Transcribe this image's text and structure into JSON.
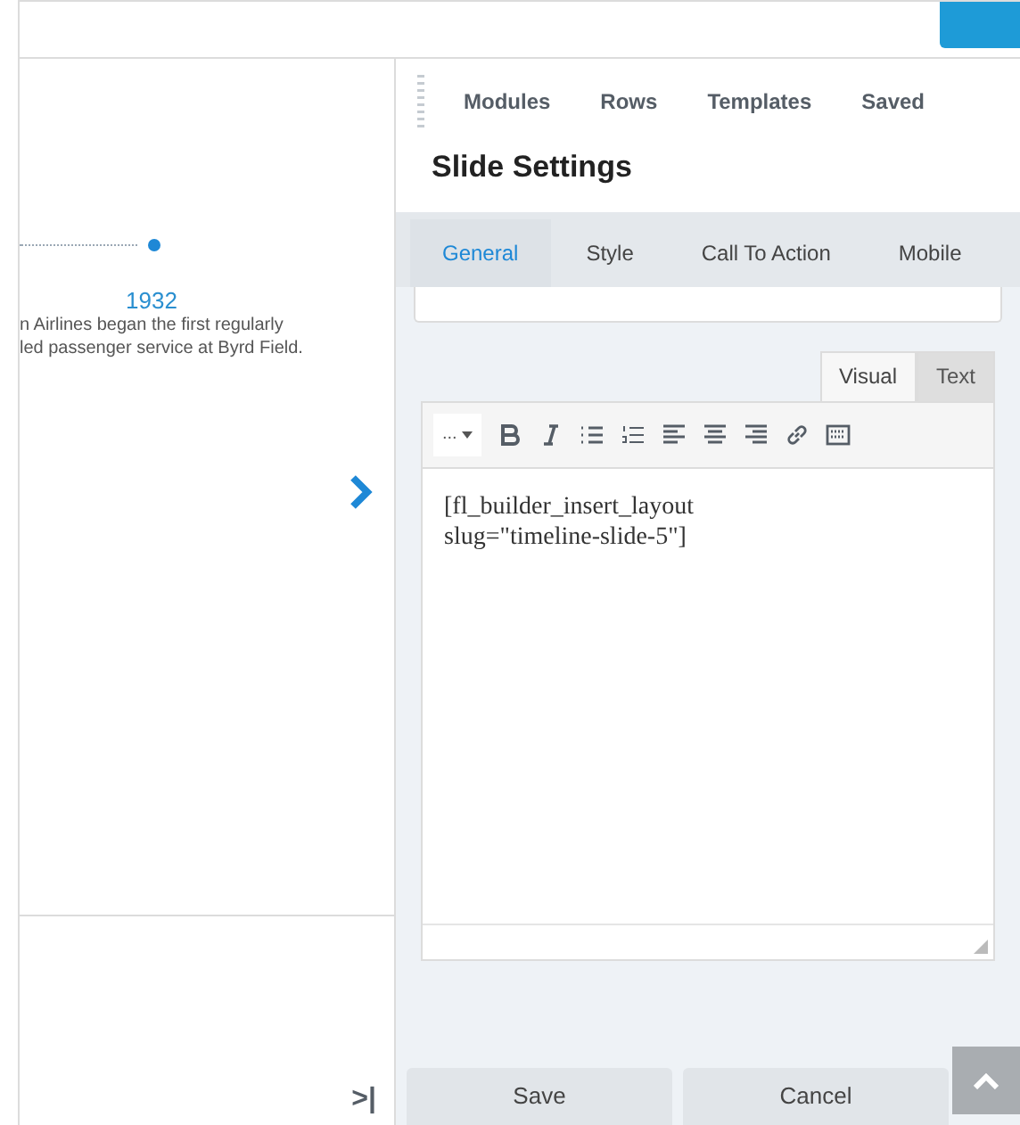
{
  "top_nav": [
    {
      "label": "Modules",
      "selected": false
    },
    {
      "label": "Rows",
      "selected": false
    },
    {
      "label": "Templates",
      "selected": false
    },
    {
      "label": "Saved",
      "selected": false
    }
  ],
  "panel_title": "Slide Settings",
  "tabs": [
    {
      "label": "General",
      "selected": true
    },
    {
      "label": "Style",
      "selected": false
    },
    {
      "label": "Call To Action",
      "selected": false
    },
    {
      "label": "Mobile",
      "selected": false
    }
  ],
  "timeline": {
    "year": "1932",
    "lines": [
      "n Airlines began the first regularly",
      "led passenger service at Byrd Field."
    ]
  },
  "editor": {
    "modes": [
      {
        "label": "Visual",
        "selected": true
      },
      {
        "label": "Text",
        "selected": false
      }
    ],
    "format_menu": "...",
    "content": [
      "[fl_builder_insert_layout",
      "slug=\"timeline-slide-5\"]"
    ]
  },
  "collapse_label": ">|",
  "buttons": [
    "Save",
    "Cancel"
  ]
}
